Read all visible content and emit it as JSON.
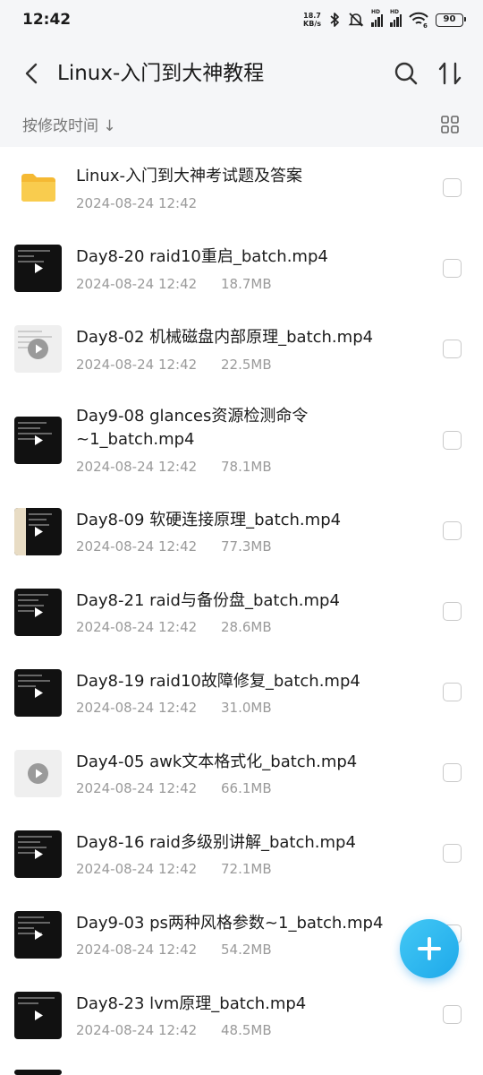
{
  "status": {
    "time": "12:42",
    "speed_top": "18.7",
    "speed_bottom": "KB/s",
    "hd1": "HD",
    "hd2": "HD",
    "wifi_badge": "6",
    "battery": "90"
  },
  "header": {
    "title": "Linux-入门到大神教程"
  },
  "subbar": {
    "sort_label": "按修改时间 ↓"
  },
  "files": [
    {
      "name": "Linux-入门到大神考试题及答案",
      "date": "2024-08-24 12:42",
      "size": "",
      "type": "folder"
    },
    {
      "name": "Day8-20 raid10重启_batch.mp4",
      "date": "2024-08-24 12:42",
      "size": "18.7MB",
      "type": "video"
    },
    {
      "name": "Day8-02 机械磁盘内部原理_batch.mp4",
      "date": "2024-08-24 12:42",
      "size": "22.5MB",
      "type": "video-light"
    },
    {
      "name": "Day9-08 glances资源检测命令~1_batch.mp4",
      "date": "2024-08-24 12:42",
      "size": "78.1MB",
      "type": "video"
    },
    {
      "name": "Day8-09 软硬连接原理_batch.mp4",
      "date": "2024-08-24 12:42",
      "size": "77.3MB",
      "type": "video"
    },
    {
      "name": "Day8-21 raid与备份盘_batch.mp4",
      "date": "2024-08-24 12:42",
      "size": "28.6MB",
      "type": "video"
    },
    {
      "name": "Day8-19 raid10故障修复_batch.mp4",
      "date": "2024-08-24 12:42",
      "size": "31.0MB",
      "type": "video"
    },
    {
      "name": "Day4-05 awk文本格式化_batch.mp4",
      "date": "2024-08-24 12:42",
      "size": "66.1MB",
      "type": "video-plain"
    },
    {
      "name": "Day8-16 raid多级别讲解_batch.mp4",
      "date": "2024-08-24 12:42",
      "size": "72.1MB",
      "type": "video"
    },
    {
      "name": "Day9-03 ps两种风格参数~1_batch.mp4",
      "date": "2024-08-24 12:42",
      "size": "54.2MB",
      "type": "video"
    },
    {
      "name": "Day8-23 lvm原理_batch.mp4",
      "date": "2024-08-24 12:42",
      "size": "48.5MB",
      "type": "video"
    }
  ],
  "colors": {
    "accent": "#2aafef",
    "folder": "#f7c743",
    "background": "#f5f6f8"
  },
  "icons": {
    "back": "chevron-left-icon",
    "search": "search-icon",
    "sort": "sort-icon",
    "grid": "grid-view-icon",
    "fab": "plus-icon"
  }
}
